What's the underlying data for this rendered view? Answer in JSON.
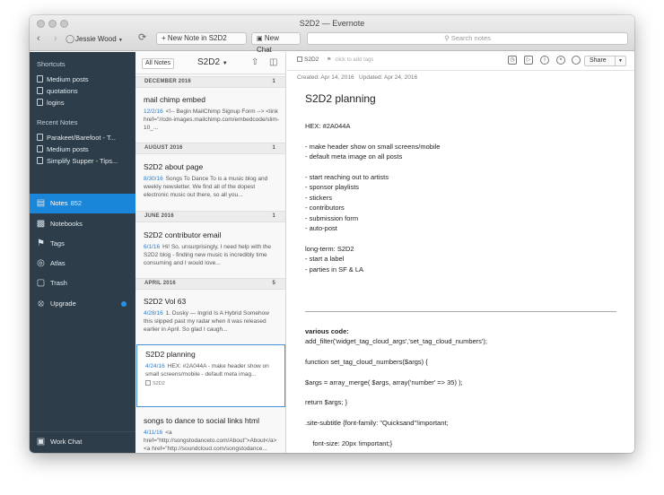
{
  "window": {
    "title": "S2D2 — Evernote"
  },
  "toolbar": {
    "user": "Jessie Wood",
    "new_note_label": "New Note in S2D2",
    "new_chat_label": "New Chat",
    "search_placeholder": "Search notes"
  },
  "sidebar": {
    "shortcuts_heading": "Shortcuts",
    "shortcuts": [
      "Medium posts",
      "quotations",
      "logins"
    ],
    "recent_heading": "Recent Notes",
    "recent": [
      "Parakeet/Barefoot - T...",
      "Medium posts",
      "Simplify Supper - Tips..."
    ],
    "nav": [
      {
        "label": "Notes",
        "count": "852",
        "icon": "note-icon"
      },
      {
        "label": "Notebooks",
        "count": "",
        "icon": "notebook-icon"
      },
      {
        "label": "Tags",
        "count": "",
        "icon": "tag-icon"
      },
      {
        "label": "Atlas",
        "count": "",
        "icon": "globe-icon"
      },
      {
        "label": "Trash",
        "count": "",
        "icon": "trash-icon"
      },
      {
        "label": "Upgrade",
        "count": "",
        "icon": "upgrade-icon"
      }
    ],
    "work_chat": "Work Chat"
  },
  "notelist": {
    "all_notes_label": "All Notes",
    "notebook_name": "S2D2",
    "sections": [
      {
        "label": "DECEMBER 2016",
        "count": "1"
      },
      {
        "label": "AUGUST 2016",
        "count": "1"
      },
      {
        "label": "JUNE 2016",
        "count": "1"
      },
      {
        "label": "APRIL 2016",
        "count": "5"
      }
    ],
    "notes": [
      {
        "title": "mail chimp embed",
        "date": "12/2/16",
        "snippet": "<!-- Begin MailChimp Signup Form --> <link href=\"//cdn-images.mailchimp.com/embedcode/slim-10_...",
        "tag": ""
      },
      {
        "title": "S2D2 about page",
        "date": "8/30/16",
        "snippet": "Songs To Dance To is a music blog and weekly newsletter. We find all of the dopest electronic music out there, so all you...",
        "tag": ""
      },
      {
        "title": "S2D2 contributor email",
        "date": "6/1/16",
        "snippet": "Hi! So, unsurprisingly, I need help with the S2D2 blog - finding new music is incredibly time consuming and I would love...",
        "tag": ""
      },
      {
        "title": "S2D2 Vol 63",
        "date": "4/28/16",
        "snippet": "1. Dusky — Ingrid Is A Hybrid Somehow this slipped past my radar when it was released earlier in April. So glad I caugh...",
        "tag": ""
      },
      {
        "title": "S2D2 planning",
        "date": "4/24/16",
        "snippet": "HEX: #2A044A - make header show on small screens/mobile - default meta imag...",
        "tag": "S2D2"
      },
      {
        "title": "songs to dance to social links html",
        "date": "4/11/16",
        "snippet": "<a href=\"http://songstodanceto.com/About\">About</a> <a href=\"http://soundcloud.com/songstodance...",
        "tag": ""
      }
    ]
  },
  "editor": {
    "notebook": "S2D2",
    "tags_placeholder": "click to add tags",
    "created": "Created: Apr 14, 2016",
    "updated": "Updated: Apr 24, 2016",
    "share_label": "Share",
    "title": "S2D2 planning",
    "body_top": "HEX: #2A044A\n\n- make header show on small screens/mobile\n- default meta image on all posts\n\n- start reaching out to artists\n- sponsor playlists\n- stickers\n- contributors\n- submission form\n- auto-post\n\nlong-term: S2D2\n- start a label\n- parties in SF & LA",
    "code_heading": "various code:",
    "body_code": "add_filter('widget_tag_cloud_args','set_tag_cloud_numbers');\n\nfunction set_tag_cloud_numbers($args) {\n\n$args = array_merge( $args, array('number' => 35) );\n\nreturn $args; }\n\n.site-subtitle {font-family: \"Quicksand\"!important;\n\n    font-size: 20px !important;}"
  }
}
